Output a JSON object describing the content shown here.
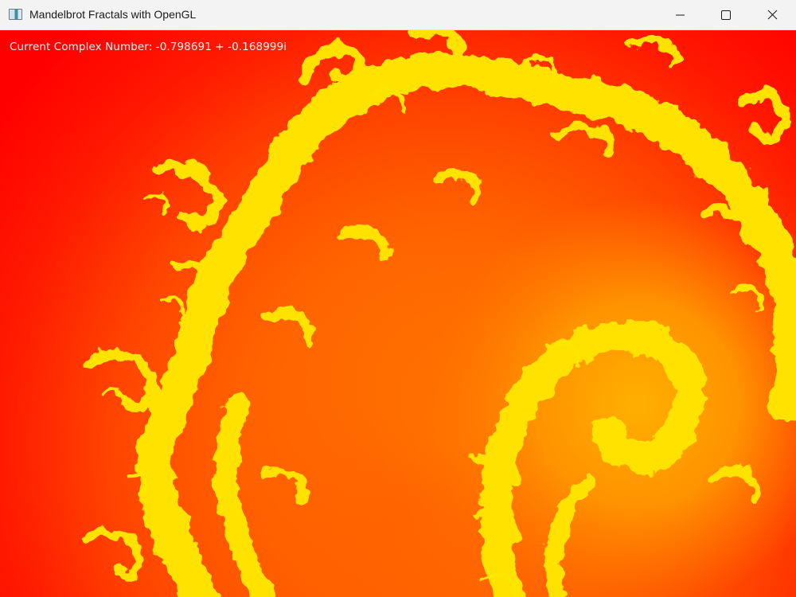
{
  "window": {
    "title": "Mandelbrot Fractals with OpenGL",
    "app_icon": "app-window-icon",
    "controls": {
      "minimize_icon": "minimize-icon",
      "maximize_icon": "maximize-icon",
      "close_icon": "close-icon"
    }
  },
  "overlay": {
    "complex_number_label": "Current Complex Number: -0.798691 + -0.168999i"
  },
  "colors": {
    "outer": "#ff0000",
    "mid": "#ff5a00",
    "inner": "#ff8c00",
    "filament": "#ffe200",
    "titlebar": "#f3f3f3"
  }
}
